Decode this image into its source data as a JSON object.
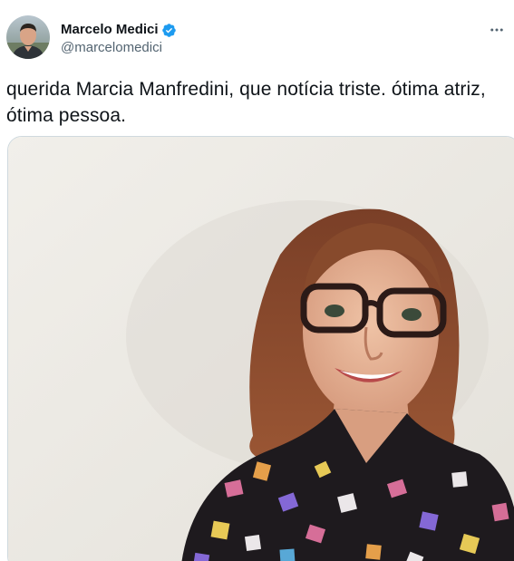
{
  "author": {
    "display_name": "Marcelo Medici",
    "handle": "@marcelomedici",
    "verified": true,
    "verified_color": "#1d9bf0"
  },
  "tweet": {
    "text": "querida Marcia Manfredini, que notícia triste. ótima atriz, ótima pessoa."
  },
  "media": {
    "type": "photo"
  },
  "icons": {
    "verified": "verified-badge-icon",
    "more": "more-options-icon"
  },
  "colors": {
    "text_primary": "#0f1419",
    "text_secondary": "#536471",
    "accent": "#1d9bf0"
  }
}
